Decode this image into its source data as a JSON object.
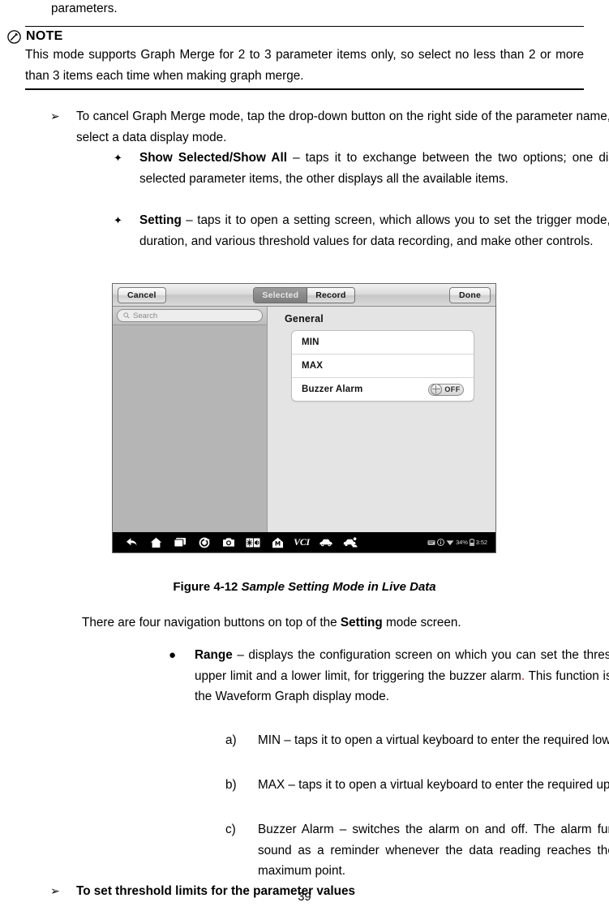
{
  "document": {
    "page_number": "39"
  },
  "continued_paragraph": {
    "text": "parameters."
  },
  "note": {
    "icon": "pencil-circle-icon",
    "title": "NOTE",
    "body": "This mode supports Graph Merge for 2 to 3 parameter items only, so select no less than 2 or more than 3 items each time when making graph merge."
  },
  "bullets": {
    "cancel_merge": {
      "marker": "➢",
      "text": "To cancel Graph Merge mode, tap the drop-down button on the right side of the parameter name, and select a data display mode."
    },
    "show_selected": {
      "marker": "✦",
      "bold_lead": "Show Selected/Show All",
      "rest": " – taps it to exchange between the two options; one displays the selected parameter items, the other displays all the available items."
    },
    "setting": {
      "marker": "✦",
      "bold_lead": "Setting",
      "rest": " – taps it to open a setting screen, which allows you to set the trigger mode, recording duration, and various threshold values for data recording, and make other controls."
    }
  },
  "figure": {
    "caption_prefix": "Figure 4-12 ",
    "caption_italic": "Sample Setting Mode in Live Data",
    "toolbar": {
      "cancel_label": "Cancel",
      "segment_selected": "Selected",
      "segment_record": "Record",
      "done_label": "Done"
    },
    "search": {
      "placeholder": "Search",
      "icon": "search-icon"
    },
    "group_title": "General",
    "rows": [
      {
        "label": "MIN",
        "control": "none"
      },
      {
        "label": "MAX",
        "control": "none"
      },
      {
        "label": "Buzzer Alarm",
        "control": "toggle",
        "toggle_state": "OFF"
      }
    ],
    "navbar": {
      "icons": [
        "back-arrow-icon",
        "home-icon",
        "recent-apps-icon",
        "chrome-browser-icon",
        "camera-icon",
        "display-sound-icon",
        "maxi-home-icon",
        "vci-icon",
        "vehicle-icon",
        "vehicle-service-icon"
      ],
      "vci_label": "VCI",
      "status": {
        "icons": [
          "message-icon",
          "info-icon",
          "wifi-icon",
          "battery-icon"
        ],
        "battery_percent": "34%",
        "clock": "3:52"
      }
    }
  },
  "body_text": {
    "nav_buttons_line_a": "There are four navigation buttons on top of the ",
    "nav_buttons_bold": "Setting",
    "nav_buttons_line_b": " mode screen."
  },
  "range_bullet": {
    "marker": "●",
    "bold_lead": "Range",
    "rest_a": " – displays the configuration screen on which you can set the threshold values, an upper limit and a lower limit, for triggering the buzzer alarm",
    "red_period": ".",
    "rest_b": " This function is only applied to the Waveform Graph display mode."
  },
  "alpha_list": [
    {
      "marker": "a)",
      "text": "MIN – taps it to open a virtual keyboard to enter the required lower limit value."
    },
    {
      "marker": "b)",
      "text": "MAX – taps it to open a virtual keyboard to enter the required upper limit value."
    },
    {
      "marker": "c)",
      "text": "Buzzer Alarm – switches the alarm on and off. The alarm function makes a beep sound as a reminder whenever the data reading reaches the preset minimum or maximum point."
    }
  ],
  "threshold_heading": {
    "marker": "➢",
    "text": "To set threshold limits for the parameter values"
  }
}
